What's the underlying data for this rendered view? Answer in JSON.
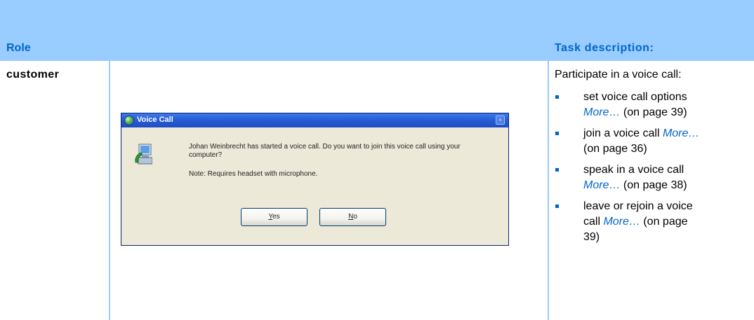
{
  "header": {
    "role_label": "Role",
    "task_label": "Task description:"
  },
  "row": {
    "role": "customer",
    "task_intro": "Participate in a voice call:",
    "tasks": [
      {
        "line1": "set voice call options",
        "line2_more": "More…",
        "line2_rest": " (on page 39)"
      },
      {
        "line1": "join a voice call ",
        "more": "More…",
        "line2_rest": "(on page 36)"
      },
      {
        "line1": "speak in a voice call",
        "line2_more": "More…",
        "line2_rest": " (on page 38)"
      },
      {
        "line1": "leave or rejoin a voice",
        "line2_pre": "call ",
        "line2_more": "More…",
        "line2_rest": " (on page",
        "line3": "39)"
      }
    ]
  },
  "dialog": {
    "title": "Voice Call",
    "close_glyph": "×",
    "message": "Johan Weinbrecht has started a voice call. Do you want to join this voice call using your computer?",
    "note": "Note: Requires headset with microphone.",
    "yes_key": "Y",
    "yes_rest": "es",
    "no_key": "N",
    "no_rest": "o"
  },
  "colors": {
    "header_bg": "#99ccff",
    "accent": "#0066cc"
  }
}
